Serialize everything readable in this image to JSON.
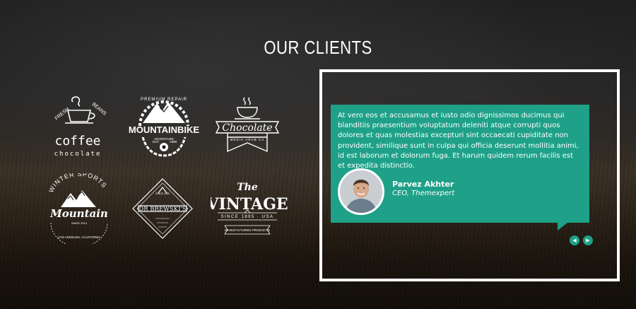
{
  "section": {
    "title": "OUR CLIENTS"
  },
  "colors": {
    "accent": "#1ea188",
    "frame": "#ffffff",
    "text": "#ffffff"
  },
  "logos": {
    "coffee": {
      "arc_left": "FRESH",
      "arc_right": "BEANS",
      "name": "coffee",
      "sub": "chocolate",
      "icon": "coffee-cup-icon"
    },
    "mountainbike": {
      "top": "PREMIUM REPAIR",
      "name": "MOUNTAINBIKE",
      "est_left": "EST.",
      "est_right": "1998",
      "bottom": "ADVENTURE",
      "icon": "mountain-gear-icon"
    },
    "chocolate": {
      "name": "Chocolate",
      "sub": "MEDIA·ARAB·CA",
      "icon": "cup-ribbon-icon"
    },
    "mountain": {
      "arc": "WINTER SPORTS",
      "name": "Mountain",
      "since": "SINCE 2014",
      "bottom": "LOS ANGELES, CALIFORNIA",
      "icon": "snow-peaks-icon"
    },
    "brewski": {
      "top": "SINCE 1980",
      "name": "DR BREWSKI'S",
      "icon": "diamond-badge-icon"
    },
    "vintage": {
      "the": "The",
      "name": "VINTAGE",
      "since": "SINCE 1895 · USA",
      "bottom": "MANUFACTURED PRODUCTS",
      "icon": "vintage-badge-icon"
    }
  },
  "testimonial": {
    "quote": "At vero eos et accusamus et iusto odio dignissimos ducimus qui blanditiis praesentium voluptatum deleniti atque corrupti quos dolores et quas molestias excepturi sint occaecati cupiditate non provident, similique sunt in culpa qui officia deserunt mollitia animi, id est laborum et dolorum fuga. Et harum quidem rerum facilis est et expedita distinctio.",
    "author_name": "Parvez Akhter",
    "author_role": "CEO, Themexpert"
  },
  "slider": {
    "prev_icon": "◀",
    "next_icon": "▶"
  }
}
